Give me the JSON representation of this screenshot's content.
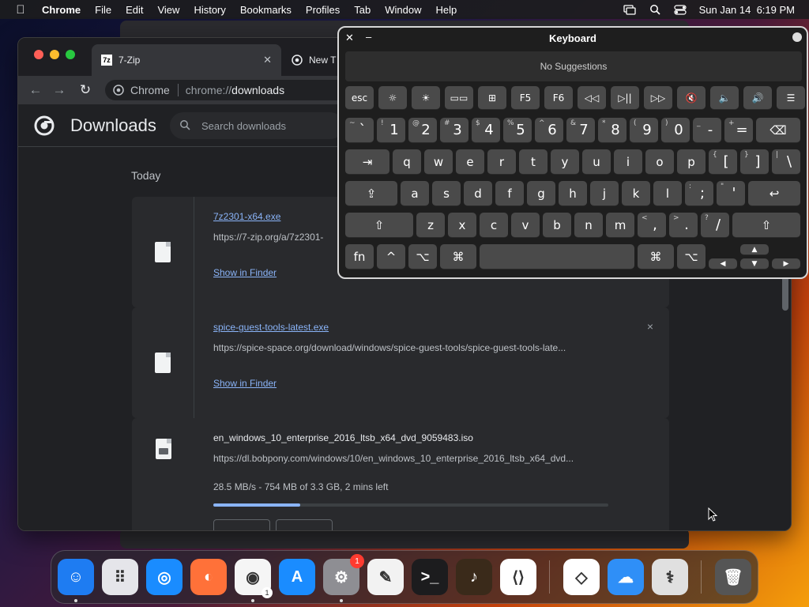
{
  "menubar": {
    "app_name": "Chrome",
    "items": [
      "File",
      "Edit",
      "View",
      "History",
      "Bookmarks",
      "Profiles",
      "Tab",
      "Window",
      "Help"
    ],
    "datetime": "Sun Jan 14  6:19 PM"
  },
  "browser": {
    "tabs": [
      {
        "label": "7-Zip",
        "favicon_text": "7z"
      },
      {
        "label": "New T"
      }
    ],
    "omnibox": {
      "chip": "Chrome",
      "url_prefix": "chrome://",
      "url_highlight": "downloads"
    }
  },
  "downloads": {
    "title": "Downloads",
    "search_placeholder": "Search downloads",
    "section": "Today",
    "items": [
      {
        "filename": "7z2301-x64.exe",
        "url": "https://7-zip.org/a/7z2301-",
        "link": "Show in Finder"
      },
      {
        "filename": "spice-guest-tools-latest.exe",
        "url": "https://spice-space.org/download/windows/spice-guest-tools/spice-guest-tools-late...",
        "link": "Show in Finder",
        "close": "×"
      },
      {
        "filename": "en_windows_10_enterprise_2016_ltsb_x64_dvd_9059483.iso",
        "url": "https://dl.bobpony.com/windows/10/en_windows_10_enterprise_2016_ltsb_x64_dvd...",
        "status": "28.5 MB/s - 754 MB of 3.3 GB, 2 mins left",
        "progress": 0.22
      }
    ]
  },
  "keyboard": {
    "title": "Keyboard",
    "suggestions": "No Suggestions",
    "row_fn": [
      "esc",
      "☼",
      "☀",
      "▭▭",
      "⊞",
      "F5",
      "F6",
      "◁◁",
      "▷||",
      "▷▷",
      "🔇",
      "🔈",
      "🔊",
      "☰"
    ],
    "row_num": [
      {
        "s": "~",
        "m": "`"
      },
      {
        "s": "!",
        "m": "1"
      },
      {
        "s": "@",
        "m": "2"
      },
      {
        "s": "#",
        "m": "3"
      },
      {
        "s": "$",
        "m": "4"
      },
      {
        "s": "%",
        "m": "5"
      },
      {
        "s": "^",
        "m": "6"
      },
      {
        "s": "&",
        "m": "7"
      },
      {
        "s": "*",
        "m": "8"
      },
      {
        "s": "(",
        "m": "9"
      },
      {
        "s": ")",
        "m": "0"
      },
      {
        "s": "_",
        "m": "-"
      },
      {
        "s": "+",
        "m": "="
      }
    ],
    "delete": "⌫",
    "tab": "⇥",
    "row_q": [
      "q",
      "w",
      "e",
      "r",
      "t",
      "y",
      "u",
      "i",
      "o",
      "p"
    ],
    "row_q_sym": [
      {
        "s": "{",
        "m": "["
      },
      {
        "s": "}",
        "m": "]"
      },
      {
        "s": "|",
        "m": "\\"
      }
    ],
    "caps": "⇪",
    "row_a": [
      "a",
      "s",
      "d",
      "f",
      "g",
      "h",
      "j",
      "k",
      "l"
    ],
    "row_a_sym": [
      {
        "s": ":",
        "m": ";"
      },
      {
        "s": "\"",
        "m": "'"
      }
    ],
    "return": "↩",
    "shift": "⇧",
    "row_z": [
      "z",
      "x",
      "c",
      "v",
      "b",
      "n",
      "m"
    ],
    "row_z_sym": [
      {
        "s": "<",
        "m": ","
      },
      {
        "s": ">",
        "m": "."
      },
      {
        "s": "?",
        "m": "/"
      }
    ],
    "fn": "fn",
    "ctrl": "^",
    "option": "⌥",
    "cmd": "⌘",
    "arrows": {
      "up": "▲",
      "left": "◀",
      "down": "▼",
      "right": "▶"
    }
  },
  "dock": {
    "apps": [
      {
        "name": "Finder",
        "glyph": "☺",
        "color": "#1e7cf2"
      },
      {
        "name": "Launchpad",
        "glyph": "⠿",
        "color": "#e5e5ea"
      },
      {
        "name": "Safari",
        "glyph": "◎",
        "color": "#1a8cff"
      },
      {
        "name": "Firefox",
        "glyph": "◐",
        "color": "#ff7139"
      },
      {
        "name": "Chrome",
        "glyph": "◉",
        "color": "#f5f5f5",
        "sub_badge": "1"
      },
      {
        "name": "App Store",
        "glyph": "A",
        "color": "#1a8cff"
      },
      {
        "name": "System Settings",
        "glyph": "⚙",
        "color": "#8e8e93",
        "badge": "1"
      },
      {
        "name": "TextEdit",
        "glyph": "✎",
        "color": "#f2f2f2"
      },
      {
        "name": "Terminal",
        "glyph": ">_",
        "color": "#1c1c1e"
      },
      {
        "name": "Instruments",
        "glyph": "♪",
        "color": "#3a2a1a"
      },
      {
        "name": "VS Code",
        "glyph": "⟨⟩",
        "color": "#ffffff"
      },
      {
        "name": "Visual Studio",
        "glyph": "◇",
        "color": "#ffffff"
      },
      {
        "name": "Weather",
        "glyph": "☁",
        "color": "#2f8ff7"
      },
      {
        "name": "Disk Utility",
        "glyph": "⚕",
        "color": "#e0e0e0"
      },
      {
        "name": "Trash",
        "glyph": "🗑",
        "color": "#555555"
      }
    ]
  }
}
